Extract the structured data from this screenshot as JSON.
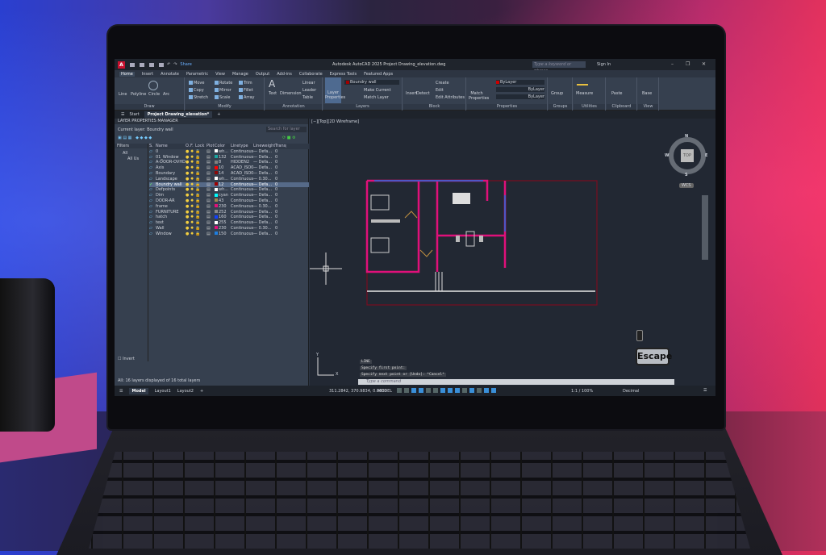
{
  "app": {
    "title": "Autodesk AutoCAD 2025   Project Drawing_elevation.dwg",
    "share": "Share",
    "search_placeholder": "Type a keyword or phrase",
    "sign_in": "Sign In"
  },
  "ribbon_tabs": [
    "Home",
    "Insert",
    "Annotate",
    "Parametric",
    "View",
    "Manage",
    "Output",
    "Add-ins",
    "Collaborate",
    "Express Tools",
    "Featured Apps"
  ],
  "ribbon": {
    "draw": {
      "label": "Draw",
      "tools": [
        "Line",
        "Polyline",
        "Circle",
        "Arc"
      ]
    },
    "modify": {
      "label": "Modify",
      "tools": [
        "Move",
        "Rotate",
        "Trim",
        "Copy",
        "Mirror",
        "Fillet",
        "Stretch",
        "Scale",
        "Array"
      ]
    },
    "annotation": {
      "label": "Annotation",
      "tools": [
        "Text",
        "Dimension",
        "Linear",
        "Leader",
        "Table"
      ]
    },
    "layers": {
      "label": "Layers",
      "layer_properties": "Layer Properties",
      "current_layer": "Boundry wall",
      "make_current": "Make Current",
      "match_layer": "Match Layer"
    },
    "block": {
      "label": "Block",
      "tools": [
        "Insert",
        "Detect",
        "Create",
        "Edit",
        "Edit Attributes"
      ]
    },
    "properties": {
      "label": "Properties",
      "match": "Match Properties",
      "color": "ByLayer",
      "linetype": "ByLayer",
      "lineweight": "ByLayer"
    },
    "groups": {
      "label": "Groups",
      "group": "Group"
    },
    "utilities": {
      "label": "Utilities",
      "measure": "Measure"
    },
    "clipboard": {
      "label": "Clipboard",
      "paste": "Paste"
    },
    "view": {
      "label": "View",
      "base": "Base"
    }
  },
  "file_tabs": {
    "start": "Start",
    "current": "Project Drawing_elevation*"
  },
  "layer_manager": {
    "title": "LAYER PROPERTIES MANAGER",
    "current_layer": "Current layer: Boundry wall",
    "search_placeholder": "Search for layer",
    "filters_label": "Filters",
    "filter_all": "All",
    "filter_all_used": "All Us",
    "invert": "Invert",
    "footer": "All: 16 layers displayed of 16 total layers",
    "columns": [
      "S.",
      "Name",
      "O.",
      "F.",
      "Lock",
      "Plot",
      "Color",
      "Linetype",
      "Lineweight",
      "Transp..."
    ],
    "layers": [
      {
        "name": "0",
        "color": "wh...",
        "hex": "#ffffff",
        "linetype": "Continuous",
        "lineweight": "Defa...",
        "transp": "0"
      },
      {
        "name": "01_Window",
        "color": "132",
        "hex": "#1aa5a0",
        "linetype": "Continuous",
        "lineweight": "Defa...",
        "transp": "0"
      },
      {
        "name": "A-DOOR-OVHD",
        "color": "8",
        "hex": "#808080",
        "linetype": "HIDDEN2",
        "lineweight": "Defa...",
        "transp": "0"
      },
      {
        "name": "Axis",
        "color": "10",
        "hex": "#ff0000",
        "linetype": "ACAD_ISO03...",
        "lineweight": "Defa...",
        "transp": "0"
      },
      {
        "name": "Boundary",
        "color": "14",
        "hex": "#8a0a0a",
        "linetype": "ACAD_ISO03...",
        "lineweight": "Defa...",
        "transp": "0"
      },
      {
        "name": "Landscape",
        "color": "wh...",
        "hex": "#ffffff",
        "linetype": "Continuous",
        "lineweight": "0.30...",
        "transp": "0"
      },
      {
        "name": "Boundry wall",
        "color": "12",
        "hex": "#a00000",
        "linetype": "Continuous",
        "lineweight": "Defa...",
        "transp": "0",
        "current": true
      },
      {
        "name": "Defpoints",
        "color": "wh...",
        "hex": "#ffffff",
        "linetype": "Continuous",
        "lineweight": "Defa...",
        "transp": "0"
      },
      {
        "name": "Dim",
        "color": "cyan",
        "hex": "#00ffff",
        "linetype": "Continuous",
        "lineweight": "Defa...",
        "transp": "0"
      },
      {
        "name": "DOOR-AR",
        "color": "43",
        "hex": "#a08a50",
        "linetype": "Continuous",
        "lineweight": "Defa...",
        "transp": "0"
      },
      {
        "name": "frame",
        "color": "230",
        "hex": "#e0107a",
        "linetype": "Continuous",
        "lineweight": "0.30...",
        "transp": "0"
      },
      {
        "name": "FURNITURE",
        "color": "252",
        "hex": "#8a8a8a",
        "linetype": "Continuous",
        "lineweight": "Defa...",
        "transp": "0"
      },
      {
        "name": "hatch",
        "color": "160",
        "hex": "#1040ff",
        "linetype": "Continuous",
        "lineweight": "Defa...",
        "transp": "0"
      },
      {
        "name": "text",
        "color": "255",
        "hex": "#ffffff",
        "linetype": "Continuous",
        "lineweight": "Defa...",
        "transp": "0"
      },
      {
        "name": "Wall",
        "color": "230",
        "hex": "#e0107a",
        "linetype": "Continuous",
        "lineweight": "0.30...",
        "transp": "0"
      },
      {
        "name": "Window",
        "color": "150",
        "hex": "#1e7ee0",
        "linetype": "Continuous",
        "lineweight": "Defa...",
        "transp": "0"
      }
    ]
  },
  "viewport": {
    "label": "[−][Top][2D Wireframe]",
    "viewcube": {
      "top": "TOP",
      "n": "N",
      "s": "S",
      "e": "E",
      "w": "W",
      "wcs": "WCS"
    },
    "ucs_x": "X",
    "ucs_y": "Y"
  },
  "command": {
    "history": [
      "LINE",
      "Specify first point:",
      "Specify next point or [Undo]: *Cancel*"
    ],
    "placeholder": "Type a command"
  },
  "key_overlay": "Escape",
  "status": {
    "layout_tabs": [
      "Model",
      "Layout1",
      "Layout2"
    ],
    "coords": "311.2842, 370.9834, 0.0000",
    "model": "MODEL",
    "scale": "1:1 / 100%",
    "units": "Decimal"
  },
  "colors": {
    "accent": "#3a8fd8",
    "wall": "#e0107a",
    "boundary": "#8a0a1a",
    "window": "#1e6ee0"
  }
}
